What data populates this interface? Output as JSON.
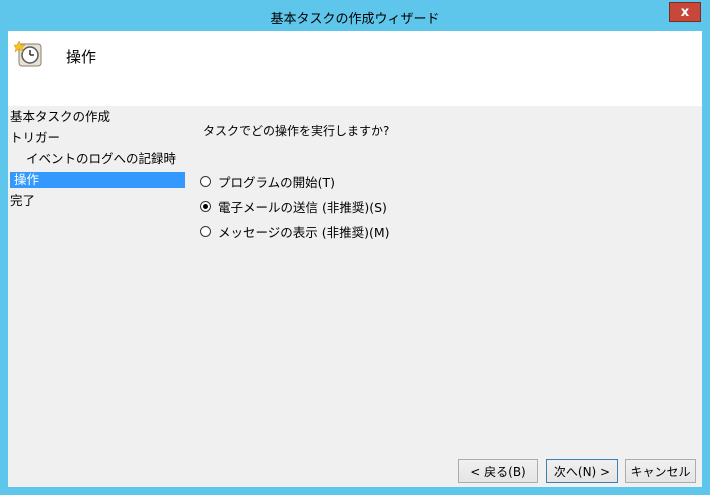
{
  "window": {
    "title": "基本タスクの作成ウィザード",
    "close_label": "x"
  },
  "header": {
    "title": "操作",
    "icon": "task-scheduler-clock-icon"
  },
  "steps": [
    {
      "label": "基本タスクの作成"
    },
    {
      "label": "トリガー"
    },
    {
      "label": "イベントのログへの記録時"
    },
    {
      "label": "操作"
    },
    {
      "label": "完了"
    }
  ],
  "question": "タスクでどの操作を実行しますか?",
  "options": [
    {
      "label": "プログラムの開始(T)",
      "checked": false
    },
    {
      "label": "電子メールの送信 (非推奨)(S)",
      "checked": true
    },
    {
      "label": "メッセージの表示 (非推奨)(M)",
      "checked": false
    }
  ],
  "buttons": {
    "back": "< 戻る(B)",
    "next": "次へ(N) >",
    "cancel": "キャンセル"
  },
  "colors": {
    "titlebar": "#5ec6ea",
    "selection": "#3399ff",
    "close": "#c7483b"
  }
}
